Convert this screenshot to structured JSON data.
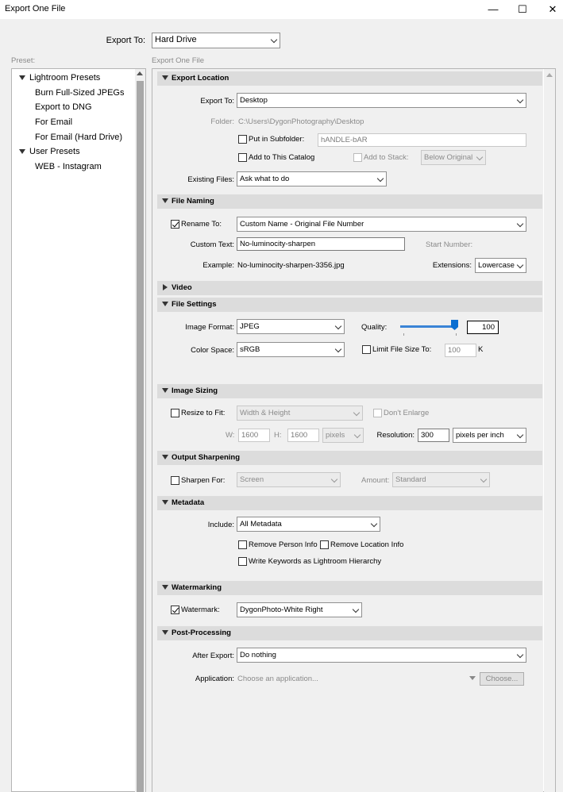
{
  "window": {
    "title": "Export One File",
    "min": "—",
    "max": "☐",
    "close": "✕"
  },
  "export_to": {
    "label": "Export To:",
    "value": "Hard Drive"
  },
  "preset_label": "Preset:",
  "panel_label": "Export One File",
  "presets": {
    "groups": [
      {
        "name": "Lightroom Presets",
        "items": [
          "Burn Full-Sized JPEGs",
          "Export to DNG",
          "For Email",
          "For Email (Hard Drive)"
        ]
      },
      {
        "name": "User Presets",
        "items": [
          "WEB - Instagram"
        ]
      }
    ]
  },
  "export_location": {
    "title": "Export Location",
    "export_to_label": "Export To:",
    "export_to_value": "Desktop",
    "folder_label": "Folder:",
    "folder_value": "C:\\Users\\DygonPhotography\\Desktop",
    "subfolder_label": "Put in Subfolder:",
    "subfolder_value": "hANDLE-bAR",
    "add_catalog_label": "Add to This Catalog",
    "add_stack_label": "Add to Stack:",
    "stack_value": "Below Original",
    "existing_label": "Existing Files:",
    "existing_value": "Ask what to do"
  },
  "file_naming": {
    "title": "File Naming",
    "rename_label": "Rename To:",
    "rename_value": "Custom Name - Original File Number",
    "custom_text_label": "Custom Text:",
    "custom_text_value": "No-luminocity-sharpen",
    "start_number_label": "Start Number:",
    "example_label": "Example:",
    "example_value": "No-luminocity-sharpen-3356.jpg",
    "extensions_label": "Extensions:",
    "extensions_value": "Lowercase"
  },
  "video": {
    "title": "Video"
  },
  "file_settings": {
    "title": "File Settings",
    "format_label": "Image Format:",
    "format_value": "JPEG",
    "quality_label": "Quality:",
    "quality_value": "100",
    "quality_fraction": 1.0,
    "color_label": "Color Space:",
    "color_value": "sRGB",
    "limit_label": "Limit File Size To:",
    "limit_value": "100",
    "limit_unit": "K"
  },
  "image_sizing": {
    "title": "Image Sizing",
    "resize_label": "Resize to Fit:",
    "resize_value": "Width & Height",
    "dont_enlarge_label": "Don't Enlarge",
    "w_label": "W:",
    "w_value": "1600",
    "h_label": "H:",
    "h_value": "1600",
    "unit_value": "pixels",
    "resolution_label": "Resolution:",
    "resolution_value": "300",
    "resolution_unit": "pixels per inch"
  },
  "output_sharpening": {
    "title": "Output Sharpening",
    "sharpen_label": "Sharpen For:",
    "sharpen_value": "Screen",
    "amount_label": "Amount:",
    "amount_value": "Standard"
  },
  "metadata": {
    "title": "Metadata",
    "include_label": "Include:",
    "include_value": "All Metadata",
    "remove_person_label": "Remove Person Info",
    "remove_location_label": "Remove Location Info",
    "write_keywords_label": "Write Keywords as Lightroom Hierarchy"
  },
  "watermarking": {
    "title": "Watermarking",
    "watermark_label": "Watermark:",
    "watermark_value": "DygonPhoto-White Right"
  },
  "post_processing": {
    "title": "Post-Processing",
    "after_label": "After Export:",
    "after_value": "Do nothing",
    "app_label": "Application:",
    "app_placeholder": "Choose an application...",
    "choose_label": "Choose..."
  }
}
